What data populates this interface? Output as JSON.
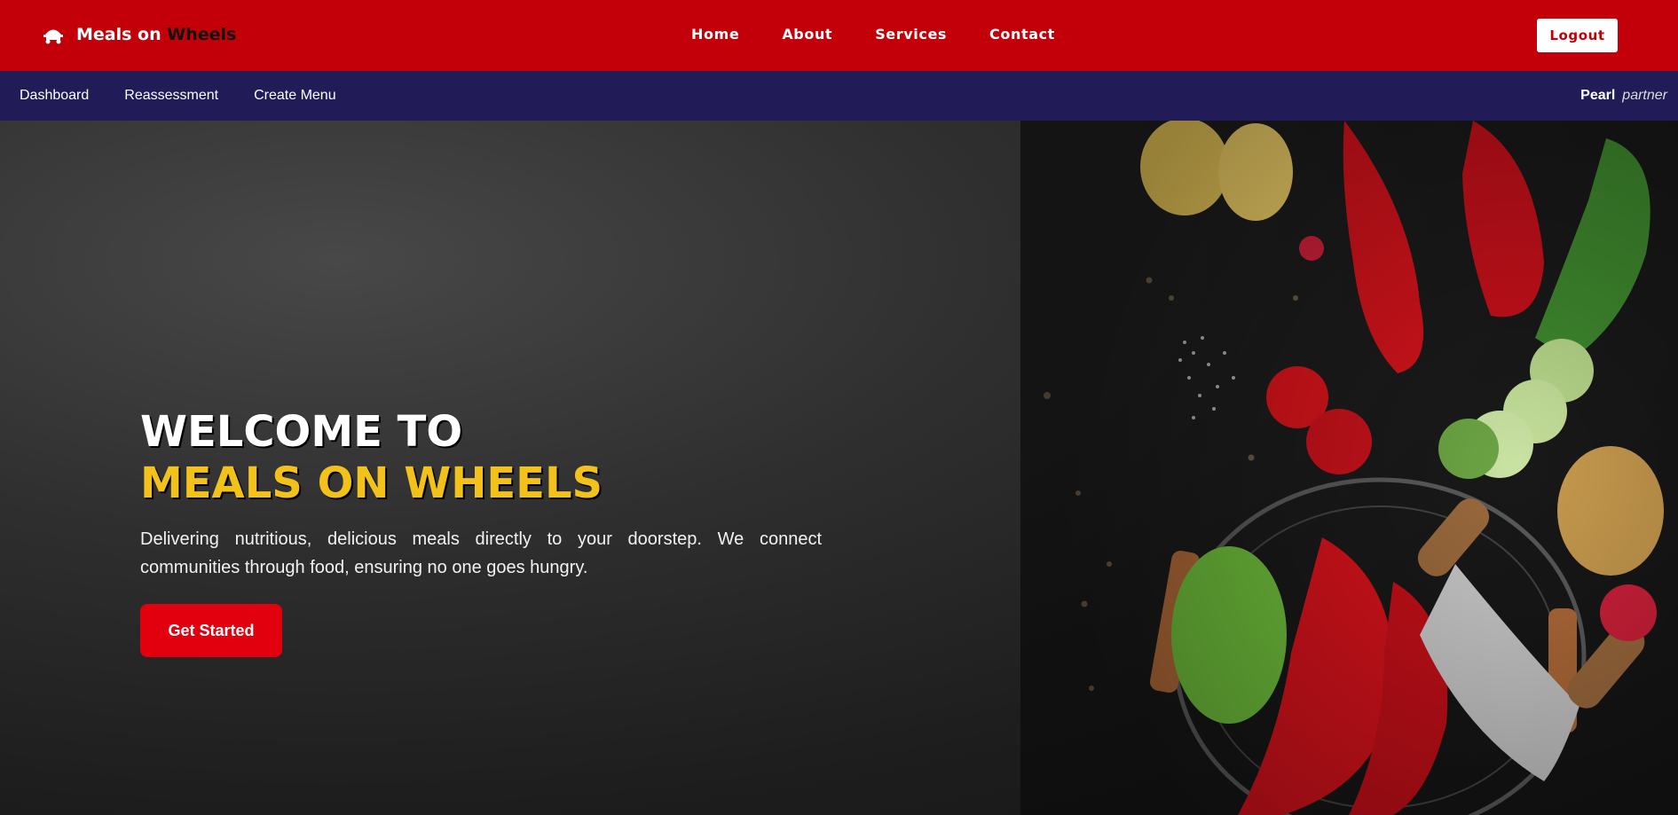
{
  "header": {
    "brand_main": "Meals on",
    "brand_accent": "Wheels",
    "brand_icon": "food-cart-icon",
    "nav": [
      {
        "label": "Home"
      },
      {
        "label": "About"
      },
      {
        "label": "Services"
      },
      {
        "label": "Contact"
      }
    ],
    "logout_label": "Logout",
    "color": "#c30009"
  },
  "subnav": {
    "items": [
      {
        "label": "Dashboard"
      },
      {
        "label": "Reassessment"
      },
      {
        "label": "Create Menu"
      }
    ],
    "user_name": "Pearl",
    "user_role": "partner",
    "color": "#211b58"
  },
  "hero": {
    "title_line1": "WELCOME TO",
    "title_line2": "MEALS ON WHEELS",
    "description": "Delivering nutritious, delicious meals directly to your doorstep. We connect communities through food, ensuring no one goes hungry.",
    "cta_label": "Get Started",
    "title_accent_color": "#f2c21a",
    "cta_color": "#e2000f"
  }
}
